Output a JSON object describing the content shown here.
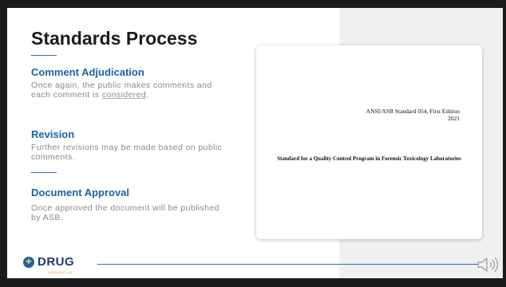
{
  "slide": {
    "title": "Standards Process",
    "sections": [
      {
        "heading": "Comment Adjudication",
        "text_before": "Once again, the public makes comments and each comment is ",
        "text_underlined": "considered",
        "text_after": "."
      },
      {
        "heading": "Revision",
        "text": "Further revisions may be made based on public comments."
      },
      {
        "heading": "Document Approval",
        "text": "Once approved the document will be published by ASB."
      }
    ]
  },
  "document": {
    "standard_line1": "ANSI/ASB Standard 054, First Edition",
    "standard_line2": "2021",
    "title": "Standard for a Quality Control Program in Forensic Toxicology Laboratories"
  },
  "logo": {
    "text": "DRUG",
    "subtext": "IMPAIRMENT.COM"
  },
  "icons": {
    "speaker": "speaker-icon",
    "logo_mark": "pill-icon"
  },
  "colors": {
    "accent": "#1a63a8",
    "heading": "#1c1c1c",
    "body_text": "#8a8a8a",
    "panel": "#f0f0f0"
  }
}
